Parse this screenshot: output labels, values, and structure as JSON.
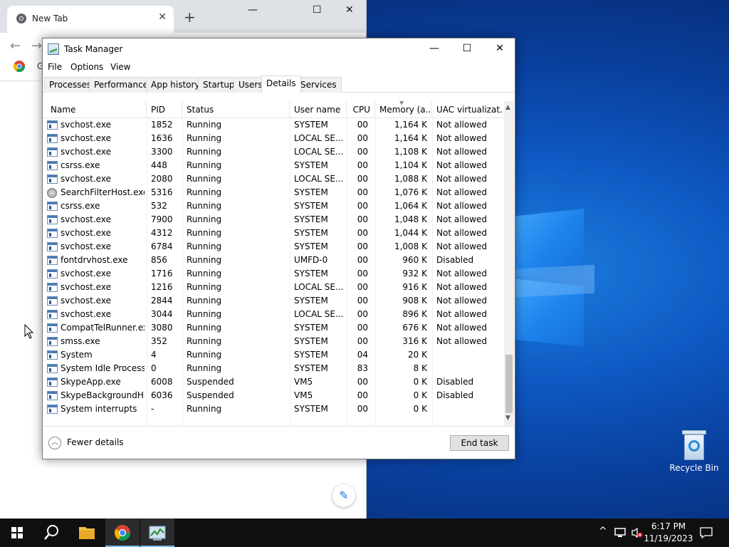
{
  "chrome": {
    "tab_title": "New Tab",
    "tab_close": "✕",
    "new_tab": "+",
    "min": "—",
    "max": "☐",
    "close": "✕",
    "back": "←",
    "forward": "→",
    "bookmark_text": "G",
    "edit_icon": "✎"
  },
  "taskmanager": {
    "title": "Task Manager",
    "min": "—",
    "max": "☐",
    "close": "✕",
    "menu": [
      "File",
      "Options",
      "View"
    ],
    "tabs": [
      "Processes",
      "Performance",
      "App history",
      "Startup",
      "Users",
      "Details",
      "Services"
    ],
    "active_tab": "Details",
    "columns": [
      "Name",
      "PID",
      "Status",
      "User name",
      "CPU",
      "Memory (a...",
      "UAC virtualizat..."
    ],
    "rows": [
      {
        "name": "svchost.exe",
        "pid": "1852",
        "status": "Running",
        "user": "SYSTEM",
        "cpu": "00",
        "mem": "1,164 K",
        "uac": "Not allowed",
        "icon": "window"
      },
      {
        "name": "svchost.exe",
        "pid": "1636",
        "status": "Running",
        "user": "LOCAL SE...",
        "cpu": "00",
        "mem": "1,164 K",
        "uac": "Not allowed",
        "icon": "window"
      },
      {
        "name": "svchost.exe",
        "pid": "3300",
        "status": "Running",
        "user": "LOCAL SE...",
        "cpu": "00",
        "mem": "1,108 K",
        "uac": "Not allowed",
        "icon": "window"
      },
      {
        "name": "csrss.exe",
        "pid": "448",
        "status": "Running",
        "user": "SYSTEM",
        "cpu": "00",
        "mem": "1,104 K",
        "uac": "Not allowed",
        "icon": "window"
      },
      {
        "name": "svchost.exe",
        "pid": "2080",
        "status": "Running",
        "user": "LOCAL SE...",
        "cpu": "00",
        "mem": "1,088 K",
        "uac": "Not allowed",
        "icon": "window"
      },
      {
        "name": "SearchFilterHost.exe",
        "pid": "5316",
        "status": "Running",
        "user": "SYSTEM",
        "cpu": "00",
        "mem": "1,076 K",
        "uac": "Not allowed",
        "icon": "search"
      },
      {
        "name": "csrss.exe",
        "pid": "532",
        "status": "Running",
        "user": "SYSTEM",
        "cpu": "00",
        "mem": "1,064 K",
        "uac": "Not allowed",
        "icon": "window"
      },
      {
        "name": "svchost.exe",
        "pid": "7900",
        "status": "Running",
        "user": "SYSTEM",
        "cpu": "00",
        "mem": "1,048 K",
        "uac": "Not allowed",
        "icon": "window"
      },
      {
        "name": "svchost.exe",
        "pid": "4312",
        "status": "Running",
        "user": "SYSTEM",
        "cpu": "00",
        "mem": "1,044 K",
        "uac": "Not allowed",
        "icon": "window"
      },
      {
        "name": "svchost.exe",
        "pid": "6784",
        "status": "Running",
        "user": "SYSTEM",
        "cpu": "00",
        "mem": "1,008 K",
        "uac": "Not allowed",
        "icon": "window"
      },
      {
        "name": "fontdrvhost.exe",
        "pid": "856",
        "status": "Running",
        "user": "UMFD-0",
        "cpu": "00",
        "mem": "960 K",
        "uac": "Disabled",
        "icon": "window"
      },
      {
        "name": "svchost.exe",
        "pid": "1716",
        "status": "Running",
        "user": "SYSTEM",
        "cpu": "00",
        "mem": "932 K",
        "uac": "Not allowed",
        "icon": "window"
      },
      {
        "name": "svchost.exe",
        "pid": "1216",
        "status": "Running",
        "user": "LOCAL SE...",
        "cpu": "00",
        "mem": "916 K",
        "uac": "Not allowed",
        "icon": "window"
      },
      {
        "name": "svchost.exe",
        "pid": "2844",
        "status": "Running",
        "user": "SYSTEM",
        "cpu": "00",
        "mem": "908 K",
        "uac": "Not allowed",
        "icon": "window"
      },
      {
        "name": "svchost.exe",
        "pid": "3044",
        "status": "Running",
        "user": "LOCAL SE...",
        "cpu": "00",
        "mem": "896 K",
        "uac": "Not allowed",
        "icon": "window"
      },
      {
        "name": "CompatTelRunner.exe",
        "pid": "3080",
        "status": "Running",
        "user": "SYSTEM",
        "cpu": "00",
        "mem": "676 K",
        "uac": "Not allowed",
        "icon": "window"
      },
      {
        "name": "smss.exe",
        "pid": "352",
        "status": "Running",
        "user": "SYSTEM",
        "cpu": "00",
        "mem": "316 K",
        "uac": "Not allowed",
        "icon": "window"
      },
      {
        "name": "System",
        "pid": "4",
        "status": "Running",
        "user": "SYSTEM",
        "cpu": "04",
        "mem": "20 K",
        "uac": "",
        "icon": "window"
      },
      {
        "name": "System Idle Process",
        "pid": "0",
        "status": "Running",
        "user": "SYSTEM",
        "cpu": "83",
        "mem": "8 K",
        "uac": "",
        "icon": "window"
      },
      {
        "name": "SkypeApp.exe",
        "pid": "6008",
        "status": "Suspended",
        "user": "VM5",
        "cpu": "00",
        "mem": "0 K",
        "uac": "Disabled",
        "icon": "window"
      },
      {
        "name": "SkypeBackgroundH...",
        "pid": "6036",
        "status": "Suspended",
        "user": "VM5",
        "cpu": "00",
        "mem": "0 K",
        "uac": "Disabled",
        "icon": "window"
      },
      {
        "name": "System interrupts",
        "pid": "-",
        "status": "Running",
        "user": "SYSTEM",
        "cpu": "00",
        "mem": "0 K",
        "uac": "",
        "icon": "window"
      }
    ],
    "fewer_details": "Fewer details",
    "end_task": "End task"
  },
  "desktop": {
    "recycle_bin": "Recycle Bin"
  },
  "taskbar": {
    "time": "6:17 PM",
    "date": "11/19/2023",
    "tray_chevron": "^"
  },
  "colors": {
    "accent": "#0078d7",
    "taskbar": "#101010",
    "wallpaper": "#0e58c2"
  }
}
